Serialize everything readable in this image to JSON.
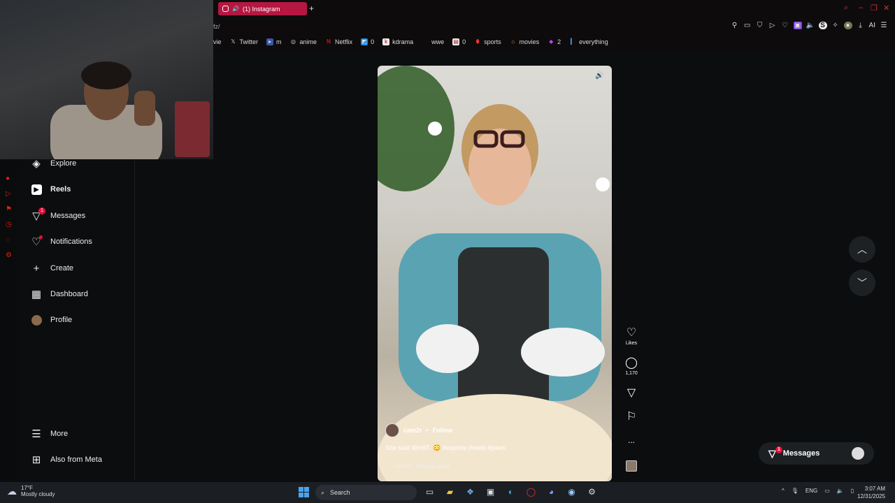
{
  "browser": {
    "tab_title": "(1) Instagram",
    "new_tab": "+",
    "url": "fz/",
    "bookmarks": [
      {
        "label": "vie",
        "icon": "bookmark-icon"
      },
      {
        "label": "Twitter",
        "icon": "x-icon"
      },
      {
        "label": "m",
        "icon": "video-icon"
      },
      {
        "label": "anime",
        "icon": "mask-icon"
      },
      {
        "label": "Netflix",
        "icon": "netflix-icon"
      },
      {
        "label": "0",
        "icon": "app-icon"
      },
      {
        "label": "kdrama",
        "icon": "k-icon"
      },
      {
        "label": "wwe",
        "icon": "wwe-icon"
      },
      {
        "label": "0",
        "icon": "news-icon"
      },
      {
        "label": "sports",
        "icon": "ball-icon"
      },
      {
        "label": "movies",
        "icon": "popcorn-icon"
      },
      {
        "label": "2",
        "icon": "gem-icon"
      },
      {
        "label": "everything",
        "icon": "bar-icon"
      }
    ],
    "ext_ai_label": "AI"
  },
  "nav": {
    "explore": "Explore",
    "reels": "Reels",
    "messages": "Messages",
    "messages_badge": "1",
    "notifications": "Notifications",
    "create": "Create",
    "dashboard": "Dashboard",
    "profile": "Profile",
    "more": "More",
    "meta": "Also from Meta"
  },
  "reel": {
    "author": "cam2r",
    "separator": "•",
    "follow": "Follow",
    "caption": "She said WHAT- 😳 #explore #reels #jokes",
    "audio": "cam2r · Original audio",
    "likes_label": "Likes",
    "comments_count": "1,170",
    "more": "..."
  },
  "messages_pill": {
    "label": "Messages",
    "badge": "1"
  },
  "taskbar": {
    "temp": "17°F",
    "weather": "Mostly cloudy",
    "search": "Search",
    "lang": "ENG",
    "time": "3:07 AM",
    "date": "12/31/2025"
  },
  "colors": {
    "accent": "#e8103b",
    "tab": "#b51742",
    "background": "#0b0d0f"
  }
}
